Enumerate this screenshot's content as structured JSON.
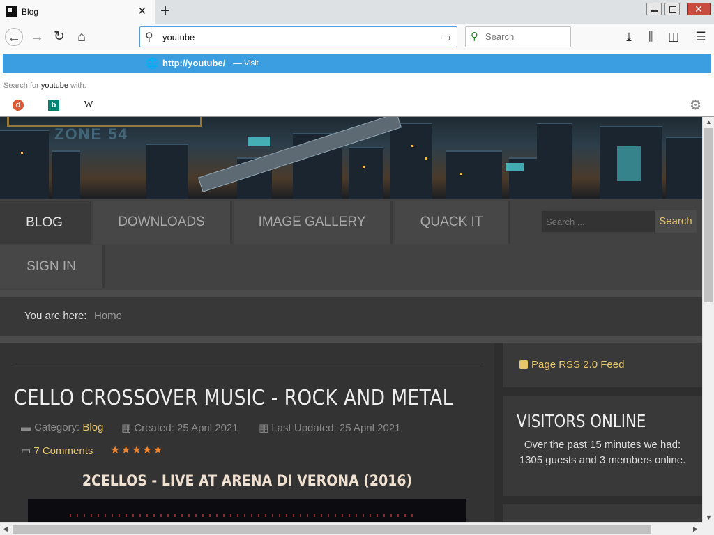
{
  "browser": {
    "tab_title": "Blog",
    "close_glyph": "×",
    "newtab_glyph": "+",
    "url_value": "youtube",
    "search_placeholder": "Search",
    "suggestion_url": "http://youtube/",
    "suggestion_dash": "—",
    "suggestion_action": "Visit",
    "search_for_prefix": "Search for ",
    "search_for_term": "youtube",
    "search_for_suffix": " with:",
    "engines": [
      "DuckDuckGo",
      "Bing",
      "Wikipedia"
    ],
    "icons": {
      "back": "back-arrow-icon",
      "forward": "forward-arrow-icon",
      "reload": "reload-icon",
      "home": "home-icon",
      "search": "search-icon",
      "go": "go-arrow-icon",
      "downloads": "download-icon",
      "library": "library-icon",
      "sidebar": "sidebar-icon",
      "menu": "hamburger-menu-icon",
      "settings": "gear-icon",
      "globe": "globe-icon"
    },
    "accent_color": "#3b9ee0"
  },
  "site": {
    "nav": [
      "BLOG",
      "DOWNLOADS",
      "IMAGE GALLERY",
      "QUACK IT",
      "SIGN IN"
    ],
    "search_placeholder": "Search ...",
    "search_button": "Search",
    "breadcrumb_label": "You are here:",
    "breadcrumb_home": "Home",
    "accent_color": "#e8c66a"
  },
  "article": {
    "title": "CELLO CROSSOVER MUSIC - ROCK AND METAL",
    "category_label": "Category: ",
    "category_value": "Blog",
    "created": "Created: 25 April 2021",
    "updated": "Last Updated: 25 April 2021",
    "comments": "7 Comments",
    "rating_stars": 5,
    "subtitle": "2CELLOS - LIVE AT ARENA DI VERONA (2016)"
  },
  "sidebar": {
    "rss": "Page RSS 2.0 Feed",
    "visitors_title": "VISITORS ONLINE",
    "visitors_text": "Over the past 15 minutes we had: 1305 guests and 3 members online."
  }
}
